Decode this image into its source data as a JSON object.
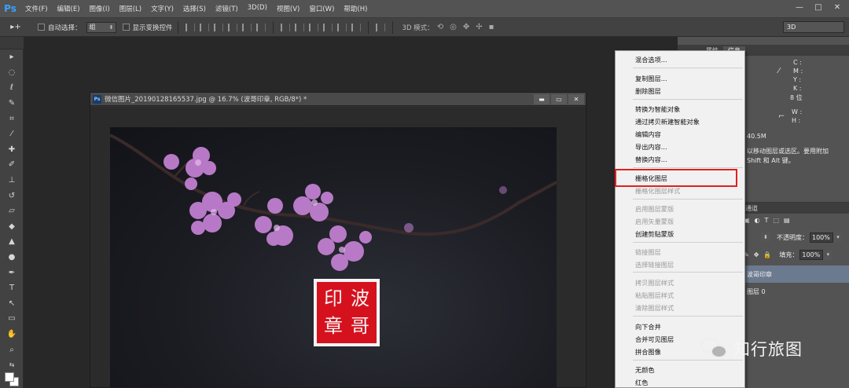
{
  "menubar": {
    "logo": "Ps",
    "items": [
      "文件(F)",
      "编辑(E)",
      "图像(I)",
      "图层(L)",
      "文字(Y)",
      "选择(S)",
      "滤镜(T)",
      "3D(D)",
      "视图(V)",
      "窗口(W)",
      "帮助(H)"
    ],
    "window_controls": [
      "—",
      "□",
      "✕"
    ]
  },
  "options_bar": {
    "tool_glyph": "▸+",
    "auto_select_label": "自动选择：",
    "auto_select_value": "组",
    "show_transform_label": "显示变换控件",
    "mode_3d_label": "3D 模式：",
    "workspace": "3D"
  },
  "document": {
    "icon": "Ps",
    "title": "微信图片_20190128165537.jpg @ 16.7% (波哥印章, RGB/8*) *",
    "buttons": [
      "▬",
      "▭",
      "✕"
    ],
    "seal_chars": [
      "波",
      "哥",
      "印",
      "章"
    ]
  },
  "panels": {
    "tabs": [
      "属性",
      "信息"
    ],
    "info": {
      "cmyk": [
        "C :",
        "M :",
        "Y :",
        "K :"
      ],
      "bit": "8 位",
      "wh": [
        "W :",
        "H :"
      ],
      "doc_size": "40.5M",
      "hint_line1": "以移动图层或选区。要用附加",
      "hint_line2": "Shift 和 Alt 键。"
    },
    "layers": {
      "tab_tail": "通道",
      "opacity_label": "不透明度：",
      "opacity_value": "100%",
      "fill_label": "填充：",
      "fill_value": "100%",
      "layer_names": [
        "波哥印章",
        "图层 0"
      ]
    }
  },
  "context_menu": {
    "items": [
      {
        "label": "混合选项...",
        "enabled": true
      },
      {
        "label": "复制图层...",
        "enabled": true
      },
      {
        "label": "删除图层",
        "enabled": true
      },
      {
        "label": "转换为智能对象",
        "enabled": true
      },
      {
        "label": "通过拷贝新建智能对象",
        "enabled": true
      },
      {
        "label": "编辑内容",
        "enabled": true
      },
      {
        "label": "导出内容...",
        "enabled": true
      },
      {
        "label": "替换内容...",
        "enabled": true
      },
      {
        "label": "栅格化图层",
        "enabled": true
      },
      {
        "label": "栅格化图层样式",
        "enabled": false
      },
      {
        "label": "启用图层蒙版",
        "enabled": false
      },
      {
        "label": "启用矢量蒙版",
        "enabled": false
      },
      {
        "label": "创建剪贴蒙版",
        "enabled": true
      },
      {
        "label": "链接图层",
        "enabled": false
      },
      {
        "label": "选择链接图层",
        "enabled": false
      },
      {
        "label": "拷贝图层样式",
        "enabled": false
      },
      {
        "label": "粘贴图层样式",
        "enabled": false
      },
      {
        "label": "清除图层样式",
        "enabled": false
      },
      {
        "label": "向下合并",
        "enabled": true
      },
      {
        "label": "合并可见图层",
        "enabled": true
      },
      {
        "label": "拼合图像",
        "enabled": true
      },
      {
        "label": "无颜色",
        "enabled": true
      },
      {
        "label": "红色",
        "enabled": true
      }
    ],
    "highlighted": "栅格化图层"
  },
  "watermark": {
    "text": "知行旅图"
  },
  "colors": {
    "accent_red": "#e02020",
    "seal_red": "#d6111e",
    "ps_blue": "#3aa2ff"
  }
}
